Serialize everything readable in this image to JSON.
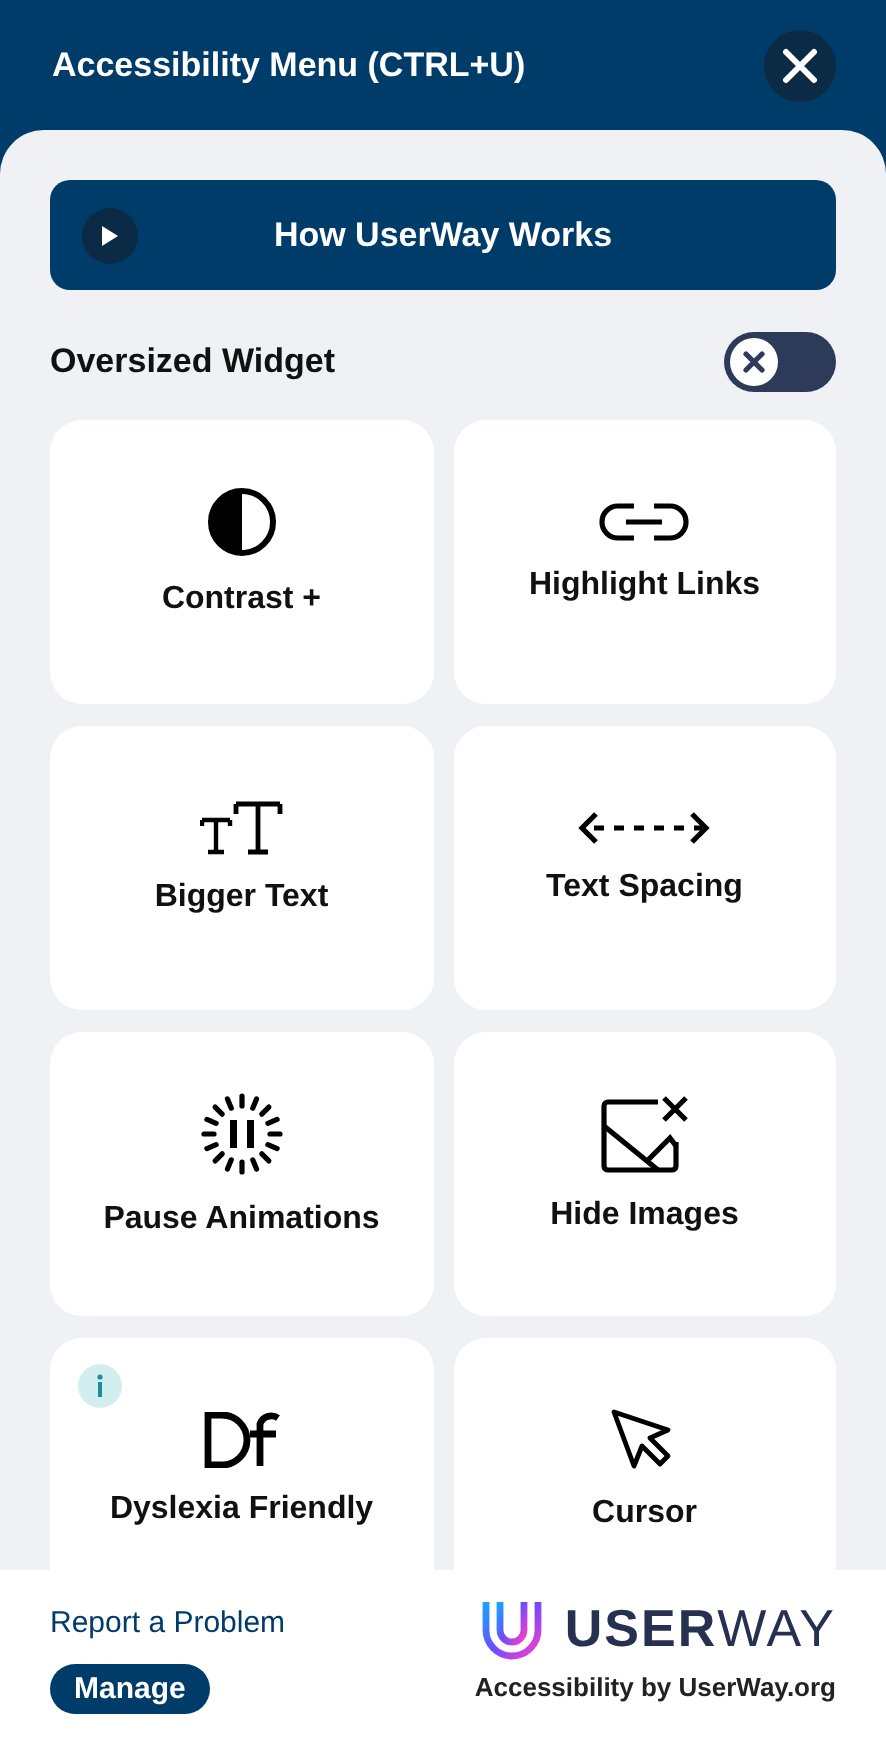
{
  "header": {
    "title": "Accessibility Menu (CTRL+U)"
  },
  "video_button": {
    "label": "How UserWay Works"
  },
  "oversized_widget": {
    "label": "Oversized Widget",
    "on": false
  },
  "features": [
    {
      "kind": "contrast",
      "label": "Contrast +",
      "info_badge": false
    },
    {
      "kind": "links",
      "label": "Highlight Links",
      "info_badge": false
    },
    {
      "kind": "bigger-text",
      "label": "Bigger Text",
      "info_badge": false
    },
    {
      "kind": "spacing",
      "label": "Text Spacing",
      "info_badge": false
    },
    {
      "kind": "pause",
      "label": "Pause Animations",
      "info_badge": false
    },
    {
      "kind": "hide-images",
      "label": "Hide Images",
      "info_badge": false
    },
    {
      "kind": "dyslexia",
      "label": "Dyslexia Friendly",
      "info_badge": true
    },
    {
      "kind": "cursor",
      "label": "Cursor",
      "info_badge": false
    }
  ],
  "footer": {
    "report_link": "Report a Problem",
    "manage_button": "Manage",
    "logo_text": "**USER**WAY",
    "tagline": "Accessibility by UserWay.org"
  }
}
